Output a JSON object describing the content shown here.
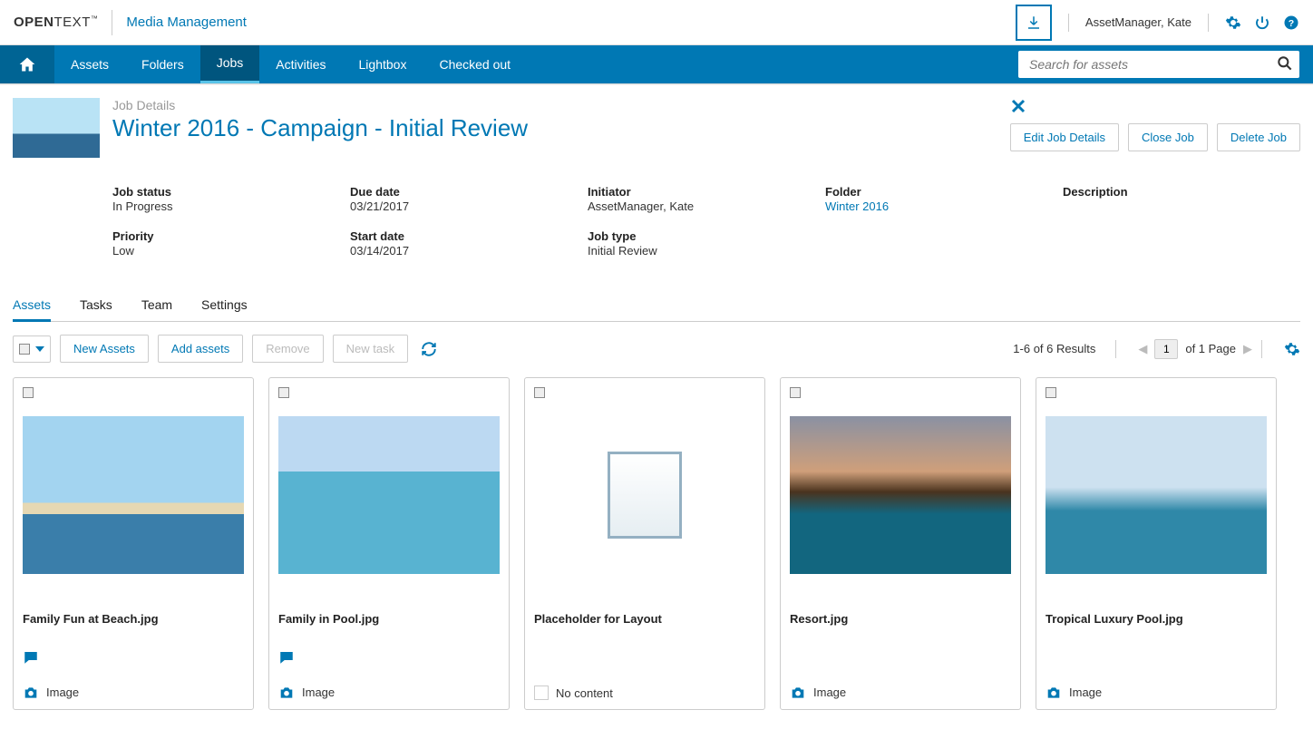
{
  "header": {
    "logo_html": "OPENTEXT",
    "tm": "™",
    "app_name": "Media Management",
    "user_name": "AssetManager, Kate"
  },
  "nav": {
    "items": [
      "Assets",
      "Folders",
      "Jobs",
      "Activities",
      "Lightbox",
      "Checked out"
    ],
    "search_placeholder": "Search for assets"
  },
  "job": {
    "subtitle": "Job Details",
    "title": "Winter 2016 - Campaign - Initial Review",
    "actions": {
      "edit": "Edit Job Details",
      "close": "Close Job",
      "delete": "Delete Job"
    },
    "details": {
      "status_label": "Job status",
      "status_value": "In Progress",
      "priority_label": "Priority",
      "priority_value": "Low",
      "due_label": "Due date",
      "due_value": "03/21/2017",
      "start_label": "Start date",
      "start_value": "03/14/2017",
      "initiator_label": "Initiator",
      "initiator_value": "AssetManager, Kate",
      "jobtype_label": "Job type",
      "jobtype_value": "Initial Review",
      "folder_label": "Folder",
      "folder_value": "Winter 2016",
      "desc_label": "Description"
    }
  },
  "subtabs": [
    "Assets",
    "Tasks",
    "Team",
    "Settings"
  ],
  "toolbar": {
    "new_assets": "New Assets",
    "add_assets": "Add assets",
    "remove": "Remove",
    "new_task": "New task"
  },
  "results": {
    "summary": "1-6 of 6 Results",
    "page": "1",
    "page_suffix": "of 1 Page"
  },
  "cards": [
    {
      "title": "Family Fun at Beach.jpg",
      "type": "Image",
      "has_comment": true,
      "placeholder": false,
      "img_class": "img-beach"
    },
    {
      "title": "Family in Pool.jpg",
      "type": "Image",
      "has_comment": true,
      "placeholder": false,
      "img_class": "img-pool"
    },
    {
      "title": "Placeholder for Layout",
      "type": "No content",
      "has_comment": false,
      "placeholder": true,
      "img_class": ""
    },
    {
      "title": "Resort.jpg",
      "type": "Image",
      "has_comment": false,
      "placeholder": false,
      "img_class": "img-resort"
    },
    {
      "title": "Tropical Luxury Pool.jpg",
      "type": "Image",
      "has_comment": false,
      "placeholder": false,
      "img_class": "img-tropical"
    }
  ]
}
